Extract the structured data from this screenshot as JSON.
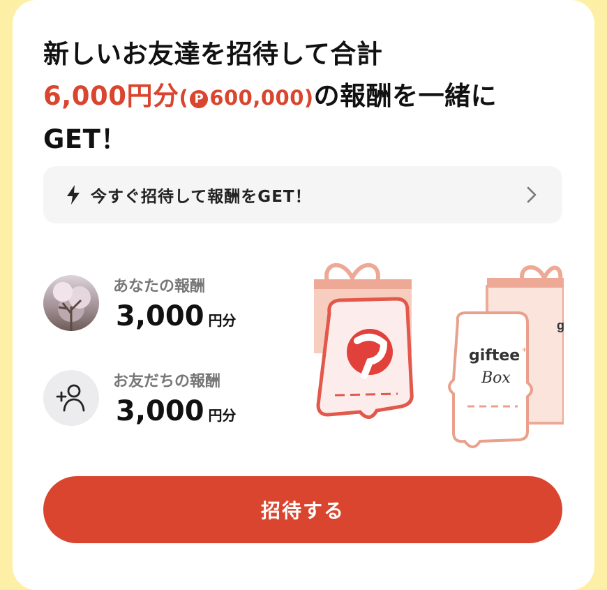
{
  "headline": {
    "line1": "新しいお友達を招待して合計",
    "amount": "6,000円分",
    "points_open": "(",
    "points_icon": "P",
    "points_value": "600,000)",
    "line2_suffix": "の報酬を一緒に",
    "line3": "GET！"
  },
  "banner": {
    "icon": "bolt-icon",
    "text": "今すぐ招待して報酬をGET！",
    "chevron": "chevron-right-icon"
  },
  "rewards": {
    "you": {
      "label": "あなたの報酬",
      "value": "3,000",
      "unit": "円分"
    },
    "friend": {
      "label": "お友だちの報酬",
      "value": "3,000",
      "unit": "円分"
    }
  },
  "illustration": {
    "gift_card_title": "giftee",
    "gift_card_subtitle": "Box",
    "partial_label": "g"
  },
  "invite_button": {
    "label": "招待する"
  },
  "colors": {
    "accent": "#d9452f",
    "background": "#fdf0a6",
    "card": "#ffffff",
    "banner_bg": "#f5f5f6"
  }
}
